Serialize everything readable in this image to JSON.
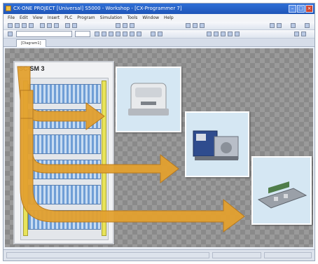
{
  "window": {
    "title": "CX-ONE PROJECT [Universal] S5000 - Workshop - [CX-Programmer 7]"
  },
  "menu": [
    "File",
    "Edit",
    "View",
    "Insert",
    "PLC",
    "Program",
    "Simulation",
    "Tools",
    "Window",
    "Help"
  ],
  "toolbar": {
    "field_value": ""
  },
  "document_tab": {
    "label": "[Diagram1]"
  },
  "diagram": {
    "cabinet_label": "SC-SM 3",
    "arrow_color": "#e3a12f",
    "arrow_targets": [
      "printer-unit",
      "filter-pump-unit",
      "control-module"
    ]
  },
  "icons": [
    "app-icon",
    "minimize-icon",
    "maximize-icon",
    "close-icon"
  ],
  "colors": {
    "titlebar": "#1f55b8",
    "arrow": "#e3a12f",
    "rack_blue": "#6f9ed6",
    "rail_yellow": "#e8e35a"
  }
}
